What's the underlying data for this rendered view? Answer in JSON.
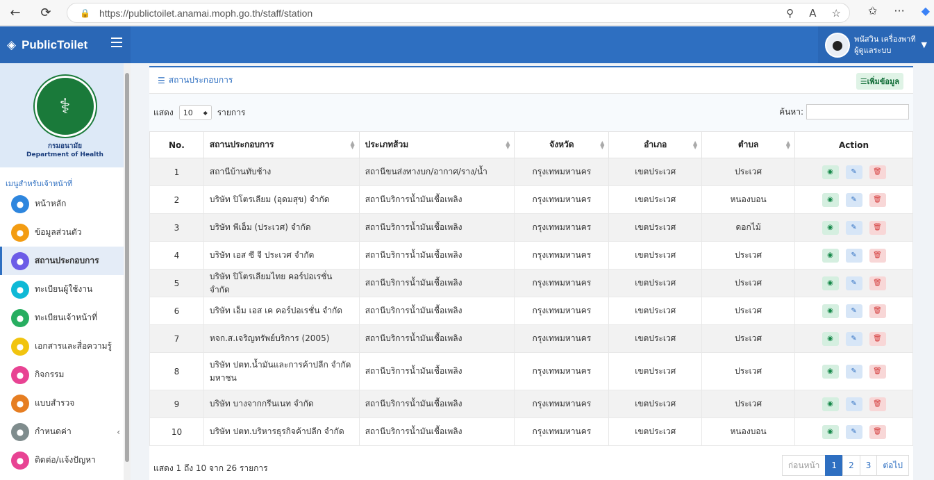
{
  "browser": {
    "url": "https://publictoilet.anamai.moph.go.th/staff/station"
  },
  "header": {
    "brand": "PublicToilet",
    "user_name": "พนัสวิน เครื่องพาที",
    "user_role": "ผู้ดูแลระบบ"
  },
  "sidebar": {
    "dept_th": "กรมอนามัย",
    "dept_en": "Department of Health",
    "menu_heading": "เมนูสำหรับเจ้าหน้าที่",
    "items": [
      {
        "label": "หน้าหลัก",
        "icon": "home-icon",
        "color": "#2e86de"
      },
      {
        "label": "ข้อมูลส่วนตัว",
        "icon": "id-card-icon",
        "color": "#f39c12"
      },
      {
        "label": "สถานประกอบการ",
        "icon": "building-icon",
        "color": "#6c5ce7"
      },
      {
        "label": "ทะเบียนผู้ใช้งาน",
        "icon": "user-icon",
        "color": "#0fb9d6"
      },
      {
        "label": "ทะเบียนเจ้าหน้าที่",
        "icon": "user-tie-icon",
        "color": "#27ae60"
      },
      {
        "label": "เอกสารและสื่อความรู้",
        "icon": "lightbulb-icon",
        "color": "#f1c40f"
      },
      {
        "label": "กิจกรรม",
        "icon": "image-icon",
        "color": "#e84393"
      },
      {
        "label": "แบบสำรวจ",
        "icon": "window-icon",
        "color": "#e67e22"
      },
      {
        "label": "กำหนดค่า",
        "icon": "cube-icon",
        "color": "#7f8c8d"
      },
      {
        "label": "ติดต่อ/แจ้งปัญหา",
        "icon": "bullhorn-icon",
        "color": "#e84393"
      }
    ]
  },
  "card": {
    "title": "สถานประกอบการ",
    "add_label": "เพิ่มข้อมูล",
    "show_label": "แสดง",
    "page_size": "10",
    "entries_label": "รายการ",
    "search_label": "ค้นหา:",
    "columns": [
      "No.",
      "สถานประกอบการ",
      "ประเภทส้วม",
      "จังหวัด",
      "อำเภอ",
      "ตำบล",
      "Action"
    ],
    "rows": [
      {
        "no": "1",
        "name": "สถานีบ้านทับช้าง",
        "type": "สถานีขนส่งทางบก/อากาศ/ราง/น้ำ",
        "province": "กรุงเทพมหานคร",
        "district": "เขตประเวศ",
        "subdistrict": "ประเวศ"
      },
      {
        "no": "2",
        "name": "บริษัท ปิโตรเลียม (อุดมสุข) จำกัด",
        "type": "สถานีบริการน้ำมันเชื้อเพลิง",
        "province": "กรุงเทพมหานคร",
        "district": "เขตประเวศ",
        "subdistrict": "หนองบอน"
      },
      {
        "no": "3",
        "name": "บริษัท พีเอ็ม (ประเวศ) จำกัด",
        "type": "สถานีบริการน้ำมันเชื้อเพลิง",
        "province": "กรุงเทพมหานคร",
        "district": "เขตประเวศ",
        "subdistrict": "ดอกไม้"
      },
      {
        "no": "4",
        "name": "บริษัท เอส ซี จี ประเวศ จำกัด",
        "type": "สถานีบริการน้ำมันเชื้อเพลิง",
        "province": "กรุงเทพมหานคร",
        "district": "เขตประเวศ",
        "subdistrict": "ประเวศ"
      },
      {
        "no": "5",
        "name": "บริษัท ปิโตรเลียมไทย คอร์ปอเรชั่น จำกัด",
        "type": "สถานีบริการน้ำมันเชื้อเพลิง",
        "province": "กรุงเทพมหานคร",
        "district": "เขตประเวศ",
        "subdistrict": "ประเวศ"
      },
      {
        "no": "6",
        "name": "บริษัท เอ็ม เอส เค คอร์ปอเรชั่น จำกัด",
        "type": "สถานีบริการน้ำมันเชื้อเพลิง",
        "province": "กรุงเทพมหานคร",
        "district": "เขตประเวศ",
        "subdistrict": "ประเวศ"
      },
      {
        "no": "7",
        "name": "หจก.ส.เจริญทรัพย์บริการ (2005)",
        "type": "สถานีบริการน้ำมันเชื้อเพลิง",
        "province": "กรุงเทพมหานคร",
        "district": "เขตประเวศ",
        "subdistrict": "ประเวศ"
      },
      {
        "no": "8",
        "name": "บริษัท ปตท.น้ำมันและการค้าปลีก จำกัด มหาชน",
        "type": "สถานีบริการน้ำมันเชื้อเพลิง",
        "province": "กรุงเทพมหานคร",
        "district": "เขตประเวศ",
        "subdistrict": "ประเวศ"
      },
      {
        "no": "9",
        "name": "บริษัท บางจากกรีนเนท จำกัด",
        "type": "สถานีบริการน้ำมันเชื้อเพลิง",
        "province": "กรุงเทพมหานคร",
        "district": "เขตประเวศ",
        "subdistrict": "ประเวศ"
      },
      {
        "no": "10",
        "name": "บริษัท ปตท.บริหารธุรกิจค้าปลีก จำกัด",
        "type": "สถานีบริการน้ำมันเชื้อเพลิง",
        "province": "กรุงเทพมหานคร",
        "district": "เขตประเวศ",
        "subdistrict": "หนองบอน"
      }
    ],
    "info": "แสดง 1 ถึง 10 จาก 26 รายการ",
    "pager": {
      "prev": "ก่อนหน้า",
      "pages": [
        "1",
        "2",
        "3"
      ],
      "next": "ต่อไป",
      "current": "1"
    }
  }
}
